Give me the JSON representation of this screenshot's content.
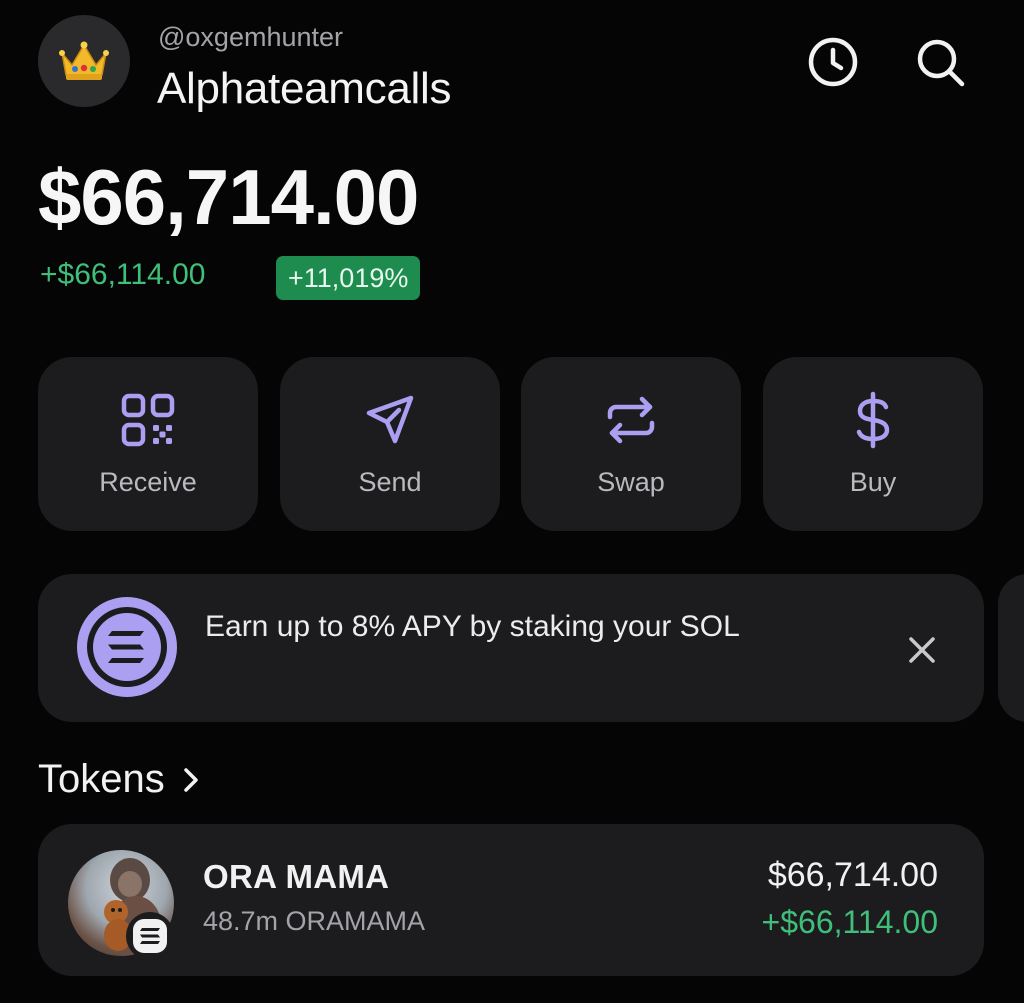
{
  "header": {
    "avatar_icon": "crown-icon",
    "handle": "@oxgemhunter",
    "account_name": "Alphateamcalls",
    "history_icon": "clock-icon",
    "search_icon": "search-icon"
  },
  "balance": {
    "total": "$66,714.00",
    "change_amount": "+$66,114.00",
    "change_percent": "+11,019%"
  },
  "actions": [
    {
      "label": "Receive",
      "icon": "qr-code-icon"
    },
    {
      "label": "Send",
      "icon": "send-icon"
    },
    {
      "label": "Swap",
      "icon": "swap-icon"
    },
    {
      "label": "Buy",
      "icon": "dollar-icon"
    }
  ],
  "banner": {
    "icon": "solana-icon",
    "text": "Earn up to 8% APY by staking your SOL",
    "close_icon": "close-icon"
  },
  "tokens": {
    "title": "Tokens",
    "items": [
      {
        "name": "ORA MAMA",
        "quantity": "48.7m ORAMAMA",
        "value": "$66,714.00",
        "change": "+$66,114.00",
        "network_icon": "solana-icon"
      }
    ]
  },
  "colors": {
    "background": "#050505",
    "card": "#1c1c1e",
    "accent_purple": "#ab9ff2",
    "positive_green": "#3fbf7a",
    "badge_green": "#1f8c4f"
  }
}
